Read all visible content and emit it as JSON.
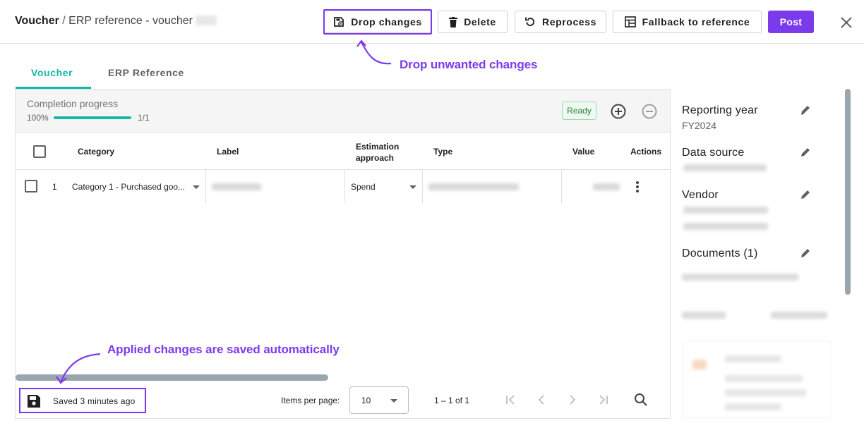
{
  "header": {
    "breadcrumb_root": "Voucher",
    "separator": " / ",
    "breadcrumb_current": "ERP reference - voucher",
    "buttons": {
      "drop_changes": "Drop changes",
      "delete": "Delete",
      "reprocess": "Reprocess",
      "fallback": "Fallback to reference",
      "post": "Post"
    }
  },
  "annotations": {
    "drop": "Drop unwanted changes",
    "saved": "Applied changes are saved automatically"
  },
  "tabs": [
    {
      "label": "Voucher",
      "active": true
    },
    {
      "label": "ERP Reference",
      "active": false
    }
  ],
  "progress": {
    "title": "Completion progress",
    "percent_label": "100%",
    "fraction": 1.0,
    "count": "1/1",
    "status": "Ready"
  },
  "table": {
    "columns": [
      "Category",
      "Label",
      "Estimation approach",
      "Type",
      "Value",
      "Actions"
    ],
    "rows": [
      {
        "index": "1",
        "category": "Category 1 - Purchased goo...",
        "approach": "Spend"
      }
    ]
  },
  "footer": {
    "saved_text": "Saved 3 minutes ago",
    "items_per_page_label": "Items per page:",
    "items_per_page_value": "10",
    "range": "1 – 1 of 1"
  },
  "sidebar": {
    "reporting_year_label": "Reporting year",
    "reporting_year_value": "FY2024",
    "data_source_label": "Data source",
    "vendor_label": "Vendor",
    "documents_label": "Documents (1)"
  },
  "colors": {
    "accent": "#7c3aed",
    "tab_active": "#14b8a6",
    "ready": "#2e7d32"
  }
}
